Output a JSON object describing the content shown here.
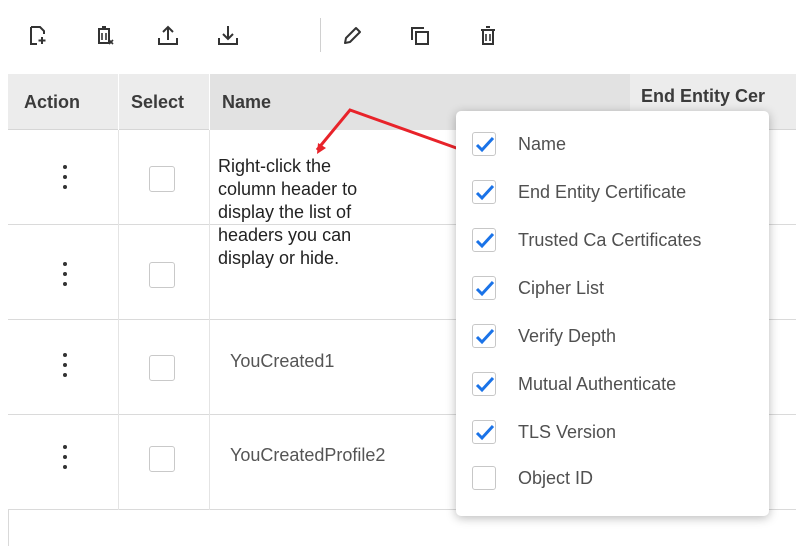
{
  "toolbar": {
    "icons": [
      "new-document-icon",
      "delete-list-icon",
      "upload-icon",
      "download-icon",
      "edit-pencil-icon",
      "copy-icon",
      "trash-icon"
    ]
  },
  "table": {
    "headers": {
      "action": "Action",
      "select": "Select",
      "name": "Name",
      "end_entity": "End Entity Cer"
    },
    "rows": [
      {
        "name": ""
      },
      {
        "name": ""
      },
      {
        "name": "YouCreated1"
      },
      {
        "name": "YouCreatedProfile2"
      }
    ]
  },
  "annotation": {
    "note": "Right-click the\ncolumn header to\ndisplay the list of\nheaders you can\ndisplay or hide.",
    "arrow_color": "#e8232a"
  },
  "column_menu": {
    "items": [
      {
        "label": "Name",
        "checked": true
      },
      {
        "label": "End Entity Certificate",
        "checked": true
      },
      {
        "label": "Trusted Ca Certificates",
        "checked": true
      },
      {
        "label": "Cipher List",
        "checked": true
      },
      {
        "label": "Verify Depth",
        "checked": true
      },
      {
        "label": "Mutual Authenticate",
        "checked": true
      },
      {
        "label": "TLS Version",
        "checked": true
      },
      {
        "label": "Object ID",
        "checked": false
      }
    ],
    "check_color": "#1a73e8"
  }
}
